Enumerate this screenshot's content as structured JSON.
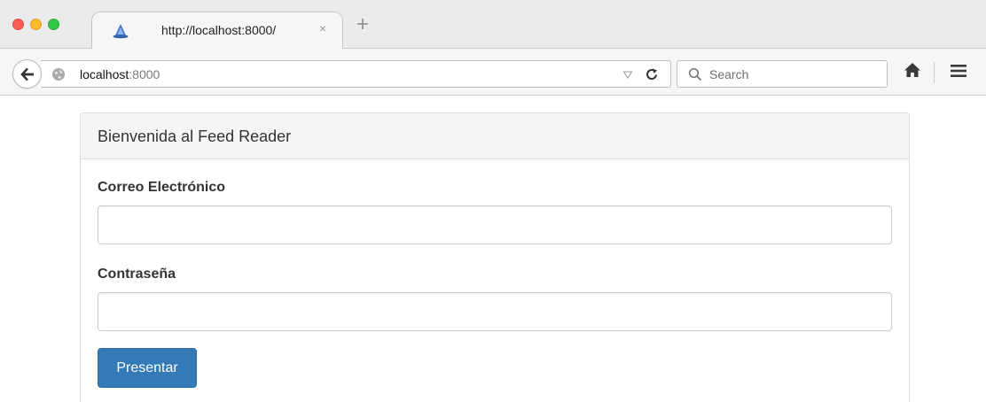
{
  "browser": {
    "tab": {
      "title": "http://localhost:8000/",
      "close_glyph": "×",
      "favicon": "firefox-logo-icon"
    },
    "new_tab_icon": "plus-icon",
    "url": {
      "host": "localhost",
      "port": ":8000"
    },
    "search": {
      "placeholder": "Search"
    },
    "icons": {
      "back": "back-arrow-icon",
      "site_identity": "globe-icon",
      "dropdown": "triangle-down-icon",
      "reload": "reload-icon",
      "search": "magnifier-icon",
      "home": "home-icon",
      "menu": "hamburger-menu-icon"
    }
  },
  "page": {
    "panel_title": "Bienvenida al Feed Reader",
    "email": {
      "label": "Correo Electrónico",
      "value": ""
    },
    "password": {
      "label": "Contraseña",
      "value": ""
    },
    "submit_label": "Presentar"
  },
  "colors": {
    "primary_button": "#337ab7",
    "panel_heading_bg": "#f5f5f5",
    "tabstrip_bg": "#ebebeb"
  }
}
